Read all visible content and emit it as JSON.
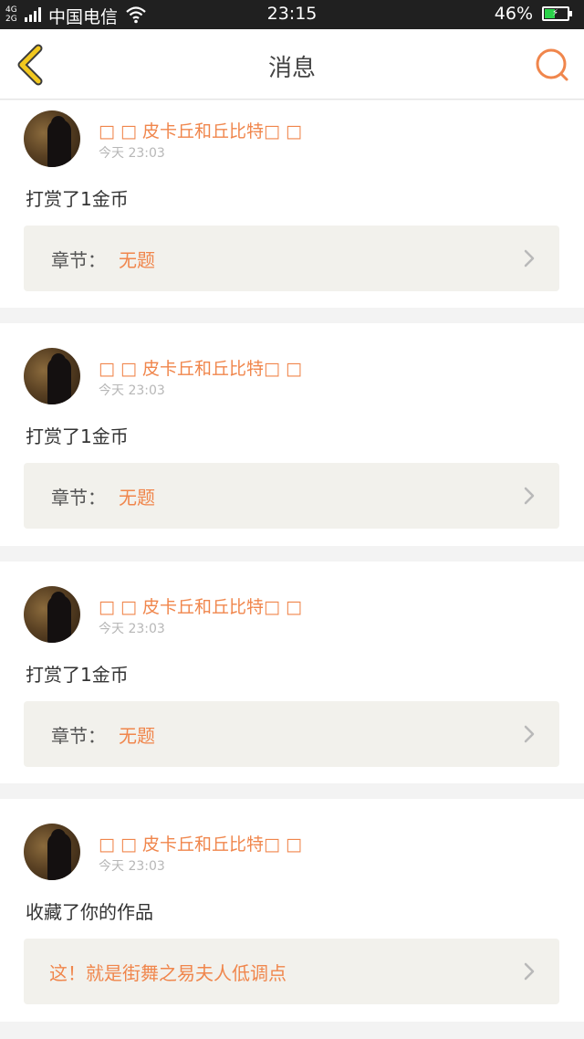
{
  "status_bar": {
    "network_top": "4G",
    "network_bottom": "2G",
    "carrier": "中国电信",
    "time": "23:15",
    "battery_text": "46%",
    "battery_level": 0.46,
    "battery_color": "#2bd34a"
  },
  "header": {
    "title": "消息",
    "back_icon": "chevron-left-icon",
    "search_icon": "search-icon",
    "accent_back": "#f2c81f",
    "accent_search": "#f0864c"
  },
  "messages": [
    {
      "username": "□ □ 皮卡丘和丘比特□ □",
      "time": "今天 23:03",
      "action": "打赏了1金币",
      "ref_label": "章节：",
      "ref_value": "无题"
    },
    {
      "username": "□ □ 皮卡丘和丘比特□ □",
      "time": "今天 23:03",
      "action": "打赏了1金币",
      "ref_label": "章节：",
      "ref_value": "无题"
    },
    {
      "username": "□ □ 皮卡丘和丘比特□ □",
      "time": "今天 23:03",
      "action": "打赏了1金币",
      "ref_label": "章节：",
      "ref_value": "无题"
    },
    {
      "username": "□ □ 皮卡丘和丘比特□ □",
      "time": "今天 23:03",
      "action": "收藏了你的作品",
      "ref_value": "这！就是街舞之易夫人低调点"
    }
  ]
}
